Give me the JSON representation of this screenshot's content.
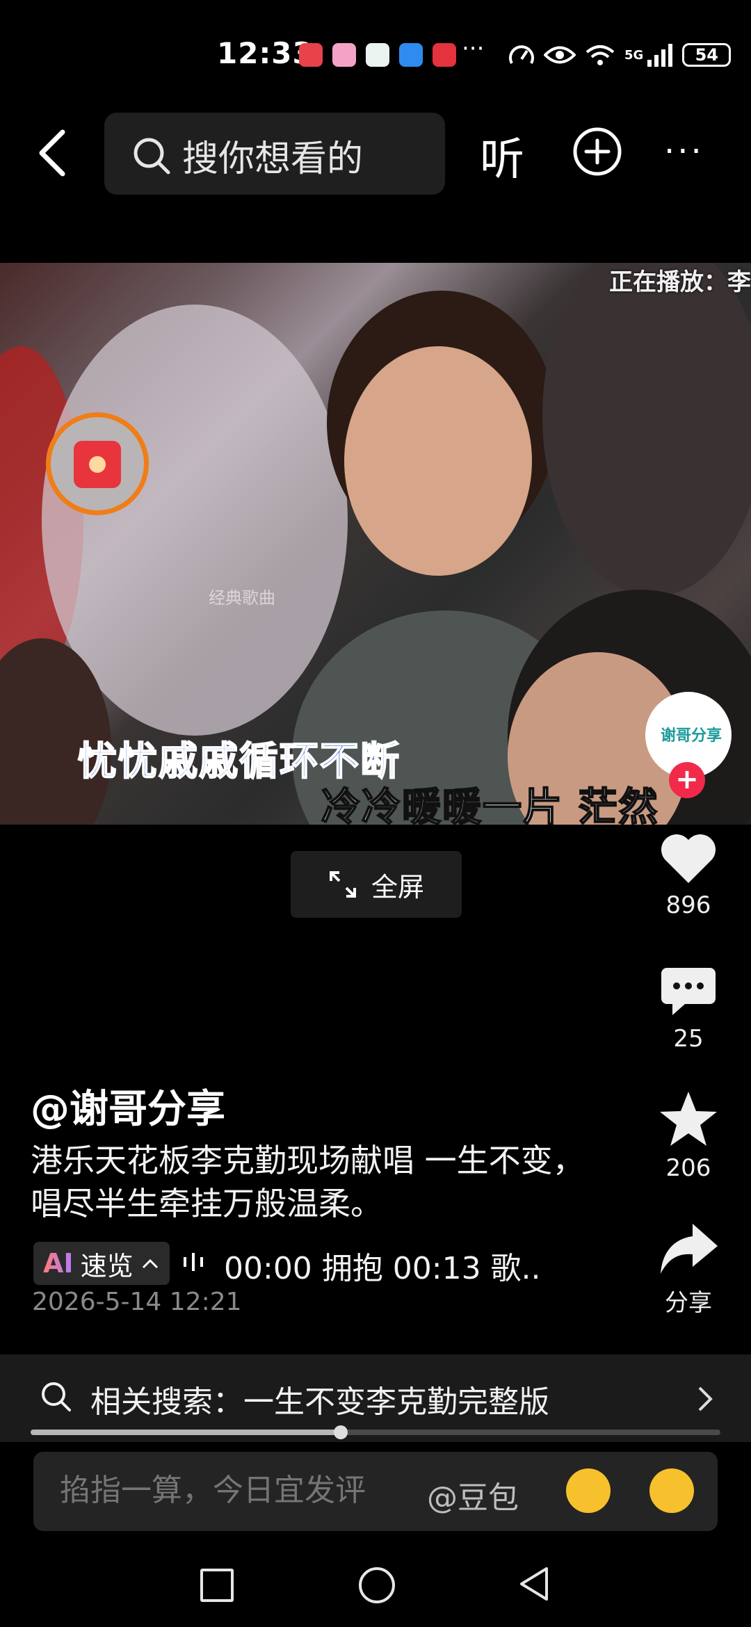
{
  "status_bar": {
    "time": "12:33",
    "more_notifications": "···",
    "network_label": "5G",
    "battery": "54"
  },
  "top_bar": {
    "search_placeholder": "搜你想看的",
    "listen_label": "听",
    "more_label": "···"
  },
  "video": {
    "now_playing": "正在播放：李",
    "watermark": "经典歌曲",
    "lyric_line1": "忧忧戚戚循环不断",
    "lyric_line2": "冷冷暖暖一片 茫然",
    "fullscreen_label": "全屏"
  },
  "actions": {
    "avatar_label": "谢哥分享",
    "follow": "+",
    "likes": "896",
    "comments": "25",
    "favorites": "206",
    "share_label": "分享"
  },
  "post": {
    "author": "@谢哥分享",
    "caption": "港乐天花板李克勤现场献唱 一生不变，唱尽半生牵挂万般温柔。",
    "ai_mark": "AI",
    "ai_summary_label": "速览",
    "chapters": "00:00 拥抱    00:13 歌..",
    "date": "2026-5-14 12:21"
  },
  "related_search": {
    "text": "相关搜索：一生不变李克勤完整版"
  },
  "progress": {
    "fraction": 0.45
  },
  "comment_bar": {
    "placeholder": "掐指一算，今日宜发评",
    "mention": "@豆包"
  },
  "colors": {
    "lyric_blue": "#2d5fe5",
    "follow_red": "#f12a4b",
    "redpacket_ring": "#f07d18"
  }
}
